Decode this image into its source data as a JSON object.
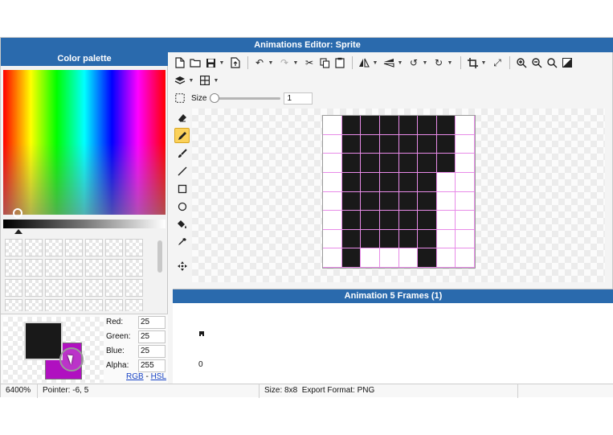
{
  "window": {
    "title": "Animations Editor: Sprite"
  },
  "palette": {
    "header": "Color palette"
  },
  "colors": {
    "primary": "#191919",
    "secondary": "#b010c0",
    "fields": [
      {
        "label": "Red:",
        "value": "25"
      },
      {
        "label": "Green:",
        "value": "25"
      },
      {
        "label": "Blue:",
        "value": "25"
      },
      {
        "label": "Alpha:",
        "value": "255"
      }
    ],
    "mode_rgb": "RGB",
    "mode_sep": " - ",
    "mode_hsl": "HSL"
  },
  "toolbar": {
    "size_label": "Size",
    "size_value": "1",
    "size_fraction": 0
  },
  "tools": [
    "eraser-icon",
    "pencil-icon",
    "brush-icon",
    "line-icon",
    "rectangle-icon",
    "ellipse-icon",
    "fill-bucket-icon",
    "eyedropper-icon",
    "move-icon"
  ],
  "active_tool": "pencil-icon",
  "sprite": {
    "pixel_color": "#191919",
    "grid_color": "#e88be8",
    "rows": [
      [
        0,
        1,
        1,
        1,
        1,
        1,
        1,
        0
      ],
      [
        0,
        1,
        1,
        1,
        1,
        1,
        1,
        0
      ],
      [
        0,
        1,
        1,
        1,
        1,
        1,
        1,
        0
      ],
      [
        0,
        1,
        1,
        1,
        1,
        1,
        0,
        0
      ],
      [
        0,
        1,
        1,
        1,
        1,
        1,
        0,
        0
      ],
      [
        0,
        1,
        1,
        1,
        1,
        1,
        0,
        0
      ],
      [
        0,
        1,
        1,
        1,
        1,
        1,
        0,
        0
      ],
      [
        0,
        1,
        0,
        0,
        0,
        1,
        0,
        0
      ]
    ]
  },
  "animation": {
    "header": "Animation 5 Frames (1)",
    "frame_index": "0"
  },
  "status": {
    "zoom": "6400%",
    "pointer": "Pointer: -6, 5",
    "size": "Size: 8x8",
    "export": "Export Format: PNG"
  }
}
